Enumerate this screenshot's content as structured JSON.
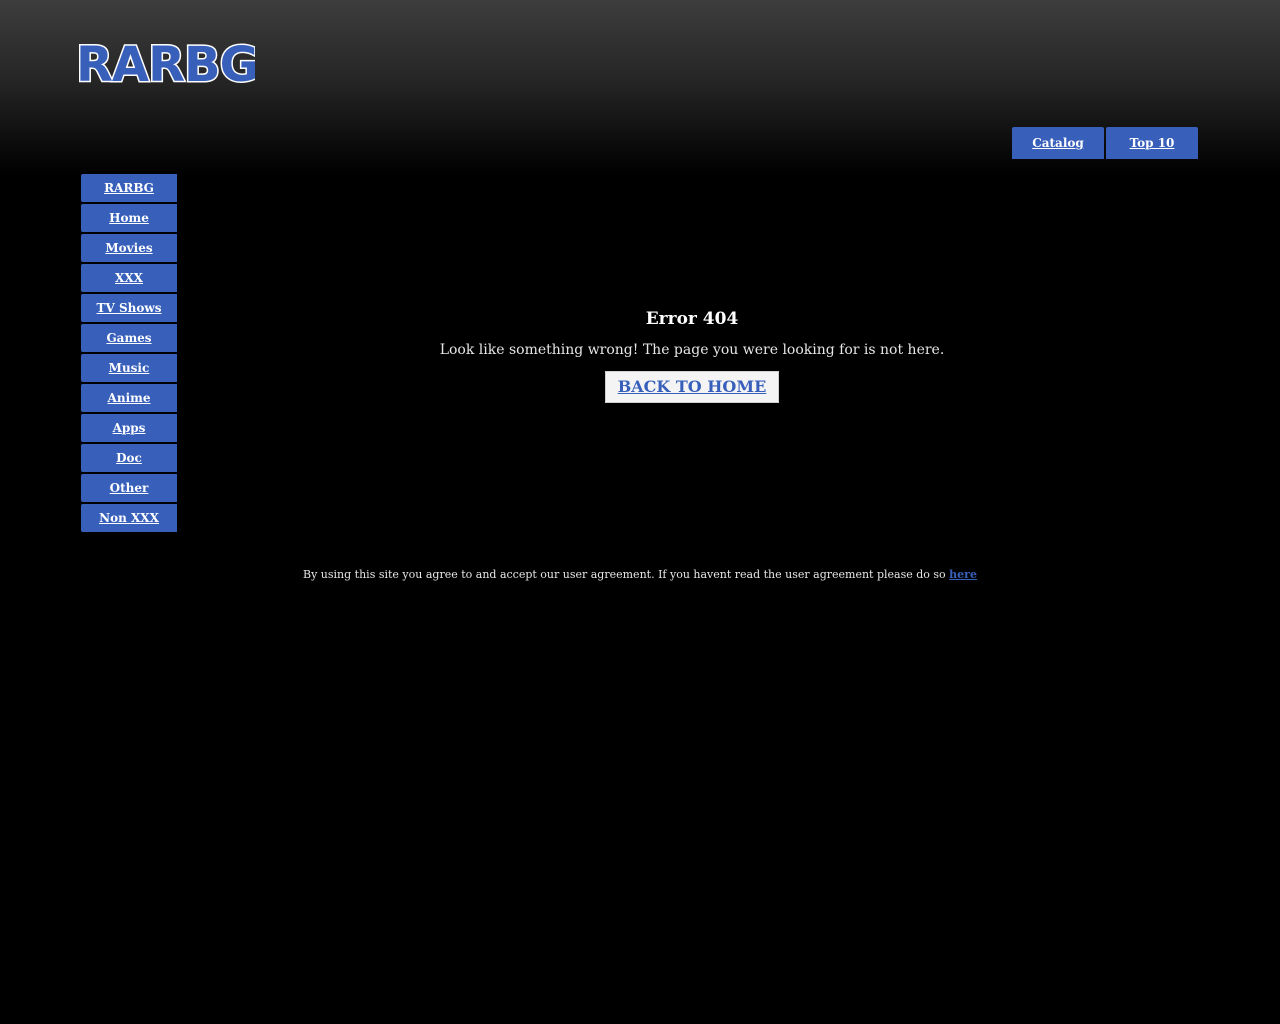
{
  "brand": {
    "logo_text": "RARBG",
    "logo_fill": "#3860bb",
    "logo_outline": "#ffffff"
  },
  "colors": {
    "nav_blue": "#3860bb",
    "background": "#000000",
    "text": "#e6e6e6"
  },
  "top_nav": {
    "items": [
      {
        "label": "Catalog"
      },
      {
        "label": "Top 10"
      }
    ]
  },
  "side_nav": {
    "items": [
      {
        "label": "RARBG"
      },
      {
        "label": "Home"
      },
      {
        "label": "Movies"
      },
      {
        "label": "XXX"
      },
      {
        "label": "TV Shows"
      },
      {
        "label": "Games"
      },
      {
        "label": "Music"
      },
      {
        "label": "Anime"
      },
      {
        "label": "Apps"
      },
      {
        "label": "Doc"
      },
      {
        "label": "Other"
      },
      {
        "label": "Non XXX"
      }
    ]
  },
  "error": {
    "title": "Error 404",
    "message": "Look like something wrong! The page you were looking for is not here.",
    "back_button": "BACK TO HOME"
  },
  "footer": {
    "text": "By using this site you agree to and accept our user agreement. If you havent read the user agreement please do so",
    "link_text": "here"
  }
}
